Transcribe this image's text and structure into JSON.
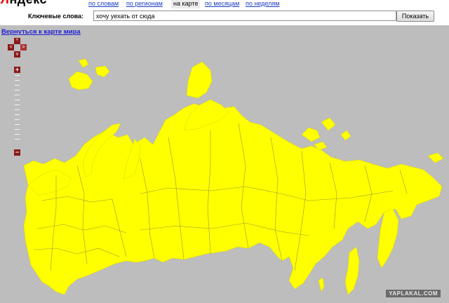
{
  "logo": {
    "first": "Я",
    "rest": "ндекс"
  },
  "tabs": [
    {
      "label": "по словам",
      "active": false
    },
    {
      "label": "по регионам",
      "active": false
    },
    {
      "label": "на карте",
      "active": true
    },
    {
      "label": "по месяцам",
      "active": false
    },
    {
      "label": "по неделям",
      "active": false
    }
  ],
  "search": {
    "label": "Ключевые слова:",
    "value": "хочу уехать от сюда",
    "button": "Показать"
  },
  "map": {
    "back_link": "Вернуться к карте мира",
    "land_color": "#ffff00",
    "background_color": "#bdbdbd",
    "zoom_in": "+",
    "zoom_out": "−",
    "pan_left": "<",
    "pan_right": ">",
    "pan_up": "^",
    "pan_down": "v"
  },
  "watermark": "YAPLAKAL.COM"
}
